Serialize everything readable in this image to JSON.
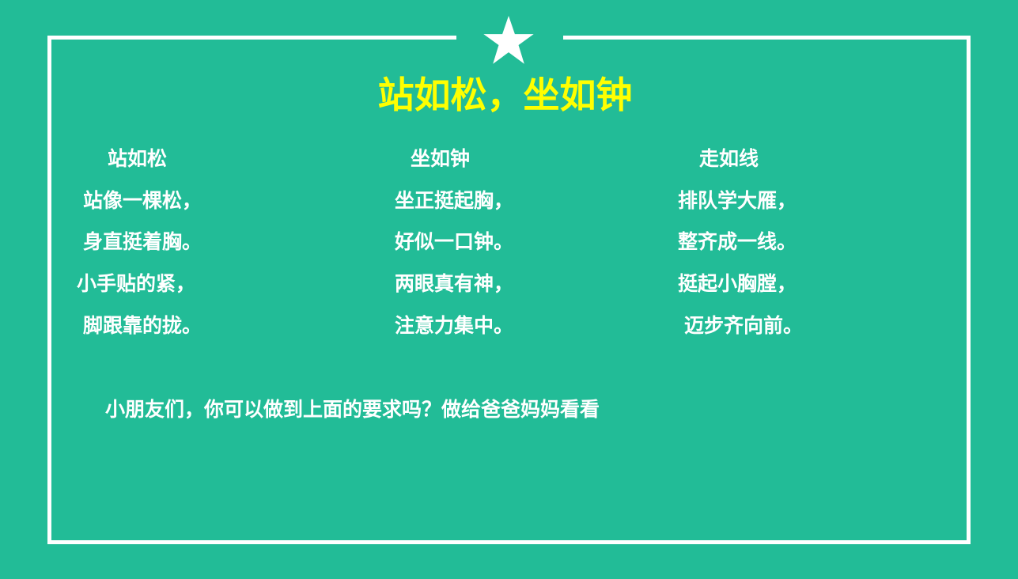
{
  "title": "站如松，坐如钟",
  "colors": {
    "background": "#22bc97",
    "title": "#ffff00",
    "text": "#ffffff"
  },
  "columns": [
    {
      "heading": "站如松",
      "lines": [
        "站像一棵松，",
        "身直挺着胸。",
        "小手贴的紧，",
        "脚跟靠的拢。"
      ]
    },
    {
      "heading": "坐如钟",
      "lines": [
        "坐正挺起胸，",
        "好似一口钟。",
        "两眼真有神，",
        "注意力集中。"
      ]
    },
    {
      "heading": "走如线",
      "lines": [
        "排队学大雁，",
        "整齐成一线。",
        "挺起小胸膛，",
        "迈步齐向前。"
      ]
    }
  ],
  "footer": "小朋友们，你可以做到上面的要求吗？做给爸爸妈妈看看"
}
